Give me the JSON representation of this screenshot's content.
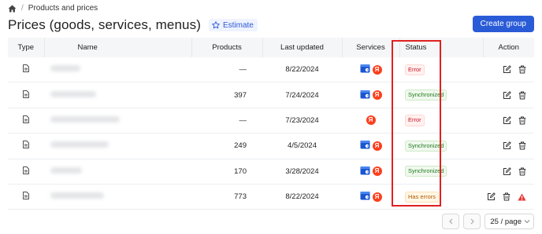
{
  "breadcrumb": {
    "home_icon": "home-icon",
    "separator": "/",
    "current": "Products and prices"
  },
  "header": {
    "title": "Prices (goods, services, menus)",
    "estimate_label": "Estimate",
    "create_button": "Create group"
  },
  "table": {
    "columns": {
      "type": "Type",
      "name": "Name",
      "products": "Products",
      "last_updated": "Last updated",
      "services": "Services",
      "status": "Status",
      "action": "Action"
    },
    "rows": [
      {
        "products": "—",
        "last_updated": "8/22/2024",
        "services": [
          "google-business-icon",
          "yandex-icon"
        ],
        "status": "Error",
        "status_kind": "error",
        "warning": false
      },
      {
        "products": "397",
        "last_updated": "7/24/2024",
        "services": [
          "google-business-icon",
          "yandex-icon"
        ],
        "status": "Synchronized",
        "status_kind": "sync",
        "warning": false
      },
      {
        "products": "—",
        "last_updated": "7/23/2024",
        "services": [
          "yandex-icon"
        ],
        "status": "Error",
        "status_kind": "error",
        "warning": false
      },
      {
        "products": "249",
        "last_updated": "4/5/2024",
        "services": [
          "google-business-icon",
          "yandex-icon"
        ],
        "status": "Synchronized",
        "status_kind": "sync",
        "warning": false
      },
      {
        "products": "170",
        "last_updated": "3/28/2024",
        "services": [
          "google-business-icon",
          "yandex-icon"
        ],
        "status": "Synchronized",
        "status_kind": "sync",
        "warning": false
      },
      {
        "products": "773",
        "last_updated": "8/22/2024",
        "services": [
          "google-business-icon",
          "yandex-icon"
        ],
        "status": "Has errors",
        "status_kind": "warn",
        "warning": true
      }
    ]
  },
  "pagination": {
    "page_size": "25 / page"
  },
  "colors": {
    "accent": "#2a5bd7",
    "error": "#cf1322",
    "success": "#237a20",
    "warning": "#b05a00",
    "highlight": "#e02020",
    "yandex": "#fc3f1d"
  }
}
